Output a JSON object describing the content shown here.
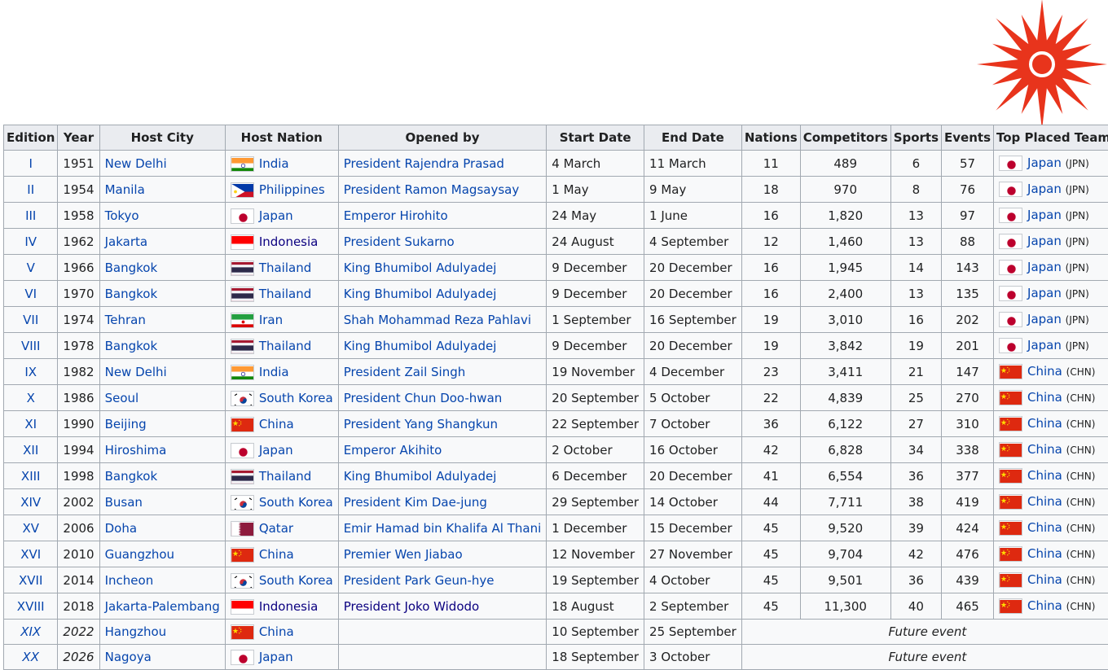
{
  "columns": [
    "Edition",
    "Year",
    "Host City",
    "Host Nation",
    "Opened by",
    "Start Date",
    "End Date",
    "Nations",
    "Competitors",
    "Sports",
    "Events",
    "Top Placed Team"
  ],
  "rows": [
    {
      "edition": "I",
      "year": "1951",
      "city": "New Delhi",
      "nation": "India",
      "flag": "india",
      "opened": "President Rajendra Prasad",
      "start": "4 March",
      "end": "11 March",
      "nations": "11",
      "competitors": "489",
      "sports": "6",
      "events": "57",
      "team": "Japan",
      "team_code": "(JPN)",
      "team_flag": "japan"
    },
    {
      "edition": "II",
      "year": "1954",
      "city": "Manila",
      "nation": "Philippines",
      "flag": "philippines",
      "opened": "President Ramon Magsaysay",
      "start": "1 May",
      "end": "9 May",
      "nations": "18",
      "competitors": "970",
      "sports": "8",
      "events": "76",
      "team": "Japan",
      "team_code": "(JPN)",
      "team_flag": "japan"
    },
    {
      "edition": "III",
      "year": "1958",
      "city": "Tokyo",
      "nation": "Japan",
      "flag": "japan",
      "opened": "Emperor Hirohito",
      "start": "24 May",
      "end": "1 June",
      "nations": "16",
      "competitors": "1,820",
      "sports": "13",
      "events": "97",
      "team": "Japan",
      "team_code": "(JPN)",
      "team_flag": "japan"
    },
    {
      "edition": "IV",
      "year": "1962",
      "city": "Jakarta",
      "nation": "Indonesia",
      "flag": "indonesia",
      "opened": "President Sukarno",
      "start": "24 August",
      "end": "4 September",
      "nations": "12",
      "competitors": "1,460",
      "sports": "13",
      "events": "88",
      "team": "Japan",
      "team_code": "(JPN)",
      "team_flag": "japan"
    },
    {
      "edition": "V",
      "year": "1966",
      "city": "Bangkok",
      "nation": "Thailand",
      "flag": "thailand",
      "opened": "King Bhumibol Adulyadej",
      "start": "9 December",
      "end": "20 December",
      "nations": "16",
      "competitors": "1,945",
      "sports": "14",
      "events": "143",
      "team": "Japan",
      "team_code": "(JPN)",
      "team_flag": "japan"
    },
    {
      "edition": "VI",
      "year": "1970",
      "city": "Bangkok",
      "nation": "Thailand",
      "flag": "thailand",
      "opened": "King Bhumibol Adulyadej",
      "start": "9 December",
      "end": "20 December",
      "nations": "16",
      "competitors": "2,400",
      "sports": "13",
      "events": "135",
      "team": "Japan",
      "team_code": "(JPN)",
      "team_flag": "japan"
    },
    {
      "edition": "VII",
      "year": "1974",
      "city": "Tehran",
      "nation": "Iran",
      "flag": "iran",
      "opened": "Shah Mohammad Reza Pahlavi",
      "start": "1 September",
      "end": "16 September",
      "nations": "19",
      "competitors": "3,010",
      "sports": "16",
      "events": "202",
      "team": "Japan",
      "team_code": "(JPN)",
      "team_flag": "japan"
    },
    {
      "edition": "VIII",
      "year": "1978",
      "city": "Bangkok",
      "nation": "Thailand",
      "flag": "thailand",
      "opened": "King Bhumibol Adulyadej",
      "start": "9 December",
      "end": "20 December",
      "nations": "19",
      "competitors": "3,842",
      "sports": "19",
      "events": "201",
      "team": "Japan",
      "team_code": "(JPN)",
      "team_flag": "japan"
    },
    {
      "edition": "IX",
      "year": "1982",
      "city": "New Delhi",
      "nation": "India",
      "flag": "india",
      "opened": "President Zail Singh",
      "start": "19 November",
      "end": "4 December",
      "nations": "23",
      "competitors": "3,411",
      "sports": "21",
      "events": "147",
      "team": "China",
      "team_code": "(CHN)",
      "team_flag": "china"
    },
    {
      "edition": "X",
      "year": "1986",
      "city": "Seoul",
      "nation": "South Korea",
      "flag": "korea",
      "opened": "President Chun Doo-hwan",
      "start": "20 September",
      "end": "5 October",
      "nations": "22",
      "competitors": "4,839",
      "sports": "25",
      "events": "270",
      "team": "China",
      "team_code": "(CHN)",
      "team_flag": "china"
    },
    {
      "edition": "XI",
      "year": "1990",
      "city": "Beijing",
      "nation": "China",
      "flag": "china",
      "opened": "President Yang Shangkun",
      "start": "22 September",
      "end": "7 October",
      "nations": "36",
      "competitors": "6,122",
      "sports": "27",
      "events": "310",
      "team": "China",
      "team_code": "(CHN)",
      "team_flag": "china"
    },
    {
      "edition": "XII",
      "year": "1994",
      "city": "Hiroshima",
      "nation": "Japan",
      "flag": "japan",
      "opened": "Emperor Akihito",
      "start": "2 October",
      "end": "16 October",
      "nations": "42",
      "competitors": "6,828",
      "sports": "34",
      "events": "338",
      "team": "China",
      "team_code": "(CHN)",
      "team_flag": "china"
    },
    {
      "edition": "XIII",
      "year": "1998",
      "city": "Bangkok",
      "nation": "Thailand",
      "flag": "thailand",
      "opened": "King Bhumibol Adulyadej",
      "start": "6 December",
      "end": "20 December",
      "nations": "41",
      "competitors": "6,554",
      "sports": "36",
      "events": "377",
      "team": "China",
      "team_code": "(CHN)",
      "team_flag": "china"
    },
    {
      "edition": "XIV",
      "year": "2002",
      "city": "Busan",
      "nation": "South Korea",
      "flag": "korea",
      "opened": "President Kim Dae-jung",
      "start": "29 September",
      "end": "14 October",
      "nations": "44",
      "competitors": "7,711",
      "sports": "38",
      "events": "419",
      "team": "China",
      "team_code": "(CHN)",
      "team_flag": "china"
    },
    {
      "edition": "XV",
      "year": "2006",
      "city": "Doha",
      "nation": "Qatar",
      "flag": "qatar",
      "opened": "Emir Hamad bin Khalifa Al Thani",
      "start": "1 December",
      "end": "15 December",
      "nations": "45",
      "competitors": "9,520",
      "sports": "39",
      "events": "424",
      "team": "China",
      "team_code": "(CHN)",
      "team_flag": "china"
    },
    {
      "edition": "XVI",
      "year": "2010",
      "city": "Guangzhou",
      "nation": "China",
      "flag": "china",
      "opened": "Premier Wen Jiabao",
      "start": "12 November",
      "end": "27 November",
      "nations": "45",
      "competitors": "9,704",
      "sports": "42",
      "events": "476",
      "team": "China",
      "team_code": "(CHN)",
      "team_flag": "china"
    },
    {
      "edition": "XVII",
      "year": "2014",
      "city": "Incheon",
      "nation": "South Korea",
      "flag": "korea",
      "opened": "President Park Geun-hye",
      "start": "19 September",
      "end": "4 October",
      "nations": "45",
      "competitors": "9,501",
      "sports": "36",
      "events": "439",
      "team": "China",
      "team_code": "(CHN)",
      "team_flag": "china"
    },
    {
      "edition": "XVIII",
      "year": "2018",
      "city": "Jakarta-Palembang",
      "nation": "Indonesia",
      "flag": "indonesia",
      "opened": "President Joko Widodo",
      "start": "18 August",
      "end": "2 September",
      "nations": "45",
      "competitors": "11,300",
      "sports": "40",
      "events": "465",
      "team": "China",
      "team_code": "(CHN)",
      "team_flag": "china"
    },
    {
      "edition": "XIX",
      "year": "2022",
      "city": "Hangzhou",
      "nation": "China",
      "flag": "china",
      "opened": "",
      "start": "10 September",
      "end": "25 September",
      "future": "Future event"
    },
    {
      "edition": "XX",
      "year": "2026",
      "city": "Nagoya",
      "nation": "Japan",
      "flag": "japan",
      "opened": "",
      "start": "18 September",
      "end": "3 October",
      "future": "Future event"
    }
  ],
  "colors": {
    "link": "#0645ad",
    "visited": "#0b0080",
    "header_bg": "#eaecf0",
    "cell_bg": "#f8f9fa",
    "border": "#a2a9b1",
    "logo": "#e8341c"
  }
}
